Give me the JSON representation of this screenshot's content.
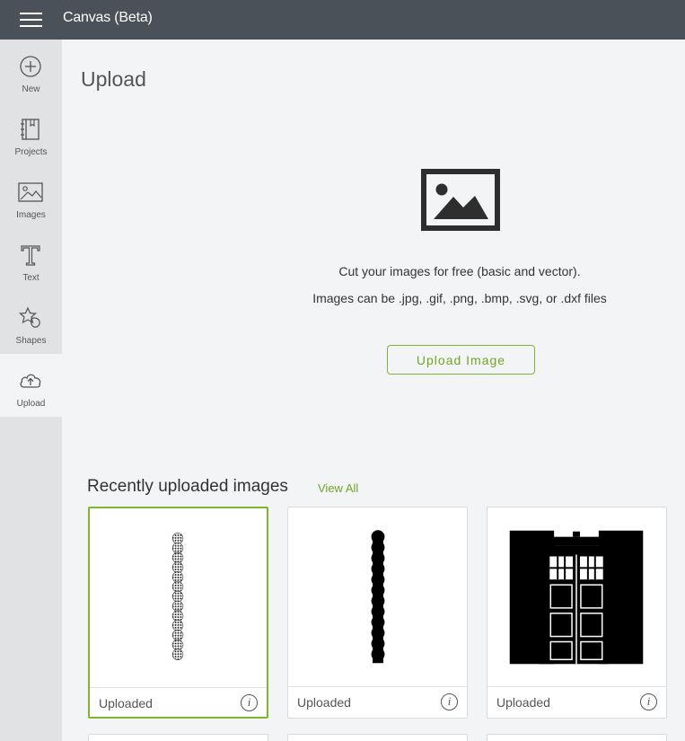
{
  "app": {
    "title": "Canvas (Beta)"
  },
  "sidebar": {
    "items": [
      {
        "label": "New",
        "icon": "plus-circle-icon"
      },
      {
        "label": "Projects",
        "icon": "notebook-icon"
      },
      {
        "label": "Images",
        "icon": "image-icon"
      },
      {
        "label": "Text",
        "icon": "text-icon"
      },
      {
        "label": "Shapes",
        "icon": "shapes-icon"
      },
      {
        "label": "Upload",
        "icon": "cloud-upload-icon"
      }
    ],
    "active": "Upload"
  },
  "main": {
    "title": "Upload",
    "description_line1": "Cut your images for free (basic and vector).",
    "description_line2": "Images can be .jpg, .gif, .png, .bmp, .svg, or .dxf files",
    "upload_button": "Upload Image"
  },
  "recent": {
    "title": "Recently uploaded images",
    "view_all": "View All",
    "cards": [
      {
        "label": "Uploaded",
        "thumbnail": "dotted-scallop-border-strip",
        "selected": true
      },
      {
        "label": "Uploaded",
        "thumbnail": "solid-scallop-border-strip",
        "selected": false
      },
      {
        "label": "Uploaded",
        "thumbnail": "police-box-silhouette",
        "selected": false
      }
    ]
  },
  "colors": {
    "topbar": "#4a5158",
    "sidebar": "#e1e2e4",
    "background": "#f3f4f5",
    "accent": "#7fb62d"
  }
}
